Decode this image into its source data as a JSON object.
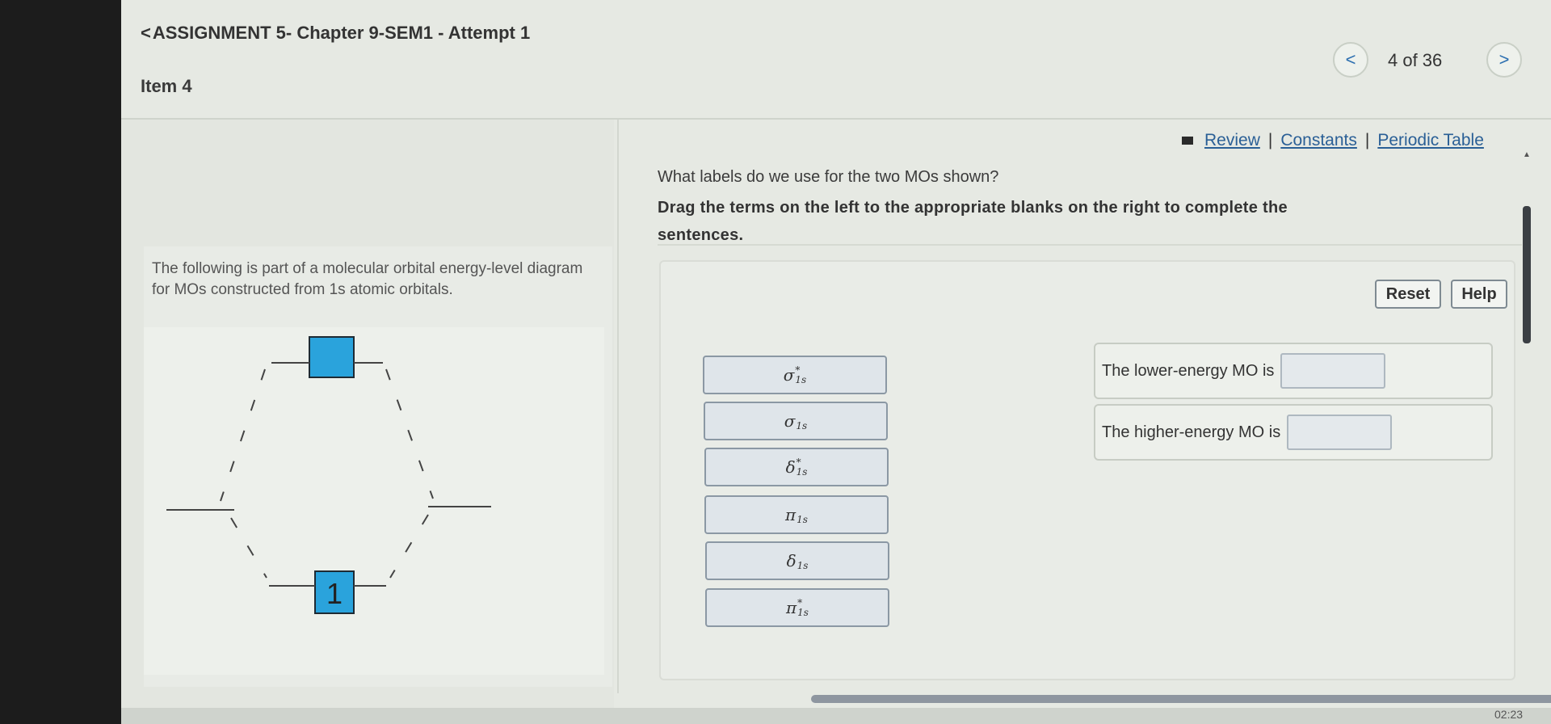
{
  "header": {
    "assignment_title": "ASSIGNMENT 5- Chapter 9-SEM1 - Attempt 1",
    "back_glyph": "<",
    "item_label": "Item 4",
    "pager": {
      "prev_glyph": "<",
      "count": "4 of 36",
      "next_glyph": ">"
    }
  },
  "resource_links": {
    "review": "Review",
    "constants": "Constants",
    "periodic_table": "Periodic Table",
    "separator": "|"
  },
  "left_panel": {
    "description": "The following is part of a molecular orbital energy-level diagram for MOs constructed from 1s atomic orbitals.",
    "diagram": {
      "lower_box_label": "1"
    }
  },
  "question": {
    "prompt": "What labels do we use for the two MOs shown?",
    "instructions": "Drag the terms on the left to the appropriate blanks on the right to complete the sentences."
  },
  "buttons": {
    "reset": "Reset",
    "help": "Help"
  },
  "terms": [
    {
      "symbol": "σ",
      "sub": "1s",
      "sup": "*"
    },
    {
      "symbol": "σ",
      "sub": "1s",
      "sup": ""
    },
    {
      "symbol": "δ",
      "sub": "1s",
      "sup": "*"
    },
    {
      "symbol": "π",
      "sub": "1s",
      "sup": ""
    },
    {
      "symbol": "δ",
      "sub": "1s",
      "sup": ""
    },
    {
      "symbol": "π",
      "sub": "1s",
      "sup": "*"
    }
  ],
  "targets": [
    {
      "text": "The lower-energy MO is"
    },
    {
      "text": "The higher-energy MO is"
    }
  ],
  "status": {
    "clock": "02:23"
  },
  "colors": {
    "mo_box": "#2aa3dc",
    "link": "#2a5f96",
    "term_bg": "#dfe5ea"
  }
}
